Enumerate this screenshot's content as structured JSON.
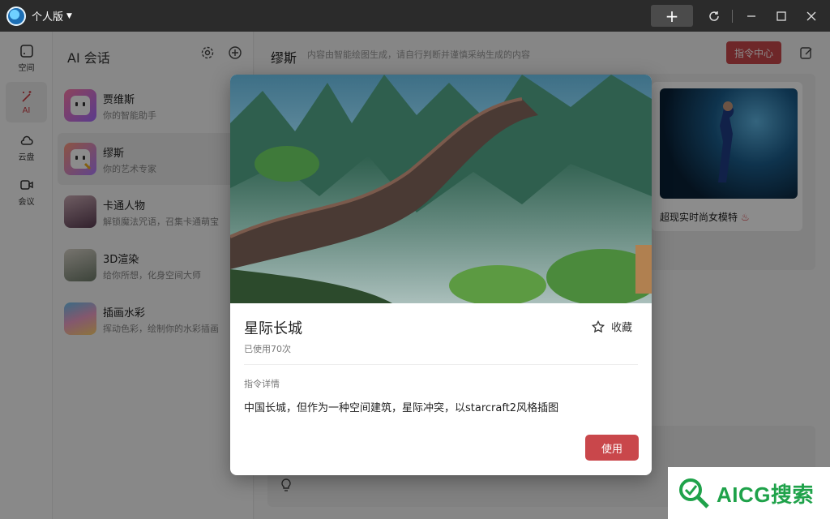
{
  "titlebar": {
    "edition": "个人版",
    "icons": [
      "add-icon",
      "sync-icon",
      "minimize-icon",
      "maximize-icon",
      "close-icon"
    ]
  },
  "rail": {
    "items": [
      {
        "label": "空间",
        "icon": "space-icon"
      },
      {
        "label": "AI",
        "icon": "ai-wand-icon"
      },
      {
        "label": "云盘",
        "icon": "cloud-icon"
      },
      {
        "label": "会议",
        "icon": "video-icon"
      }
    ]
  },
  "sessions": {
    "title": "AI 会话",
    "items": [
      {
        "name": "贾维斯",
        "desc": "你的智能助手"
      },
      {
        "name": "缪斯",
        "desc": "你的艺术专家"
      },
      {
        "name": "卡通人物",
        "desc": "解锁魔法咒语，召集卡通萌宝"
      },
      {
        "name": "3D渲染",
        "desc": "给你所想，化身空间大师"
      },
      {
        "name": "插画水彩",
        "desc": "挥动色彩，绘制你的水彩插画"
      }
    ]
  },
  "main": {
    "title": "缪斯",
    "subtitle": "内容由智能绘图生成，请自行判断并谨慎采纳生成的内容",
    "cmd_center_label": "指令中心",
    "right_card_title": "超现实时尚女模特"
  },
  "modal": {
    "title": "星际长城",
    "fav_label": "收藏",
    "usage": "已使用70次",
    "detail_label": "指令详情",
    "detail_text": "中国长城，但作为一种空间建筑，星际冲突，以starcraft2风格插图",
    "use_label": "使用"
  },
  "watermark": {
    "text": "AICG搜索"
  },
  "colors": {
    "accent": "#c9474b",
    "titlebar": "#2b2b2b",
    "watermark": "#1fa24a"
  }
}
